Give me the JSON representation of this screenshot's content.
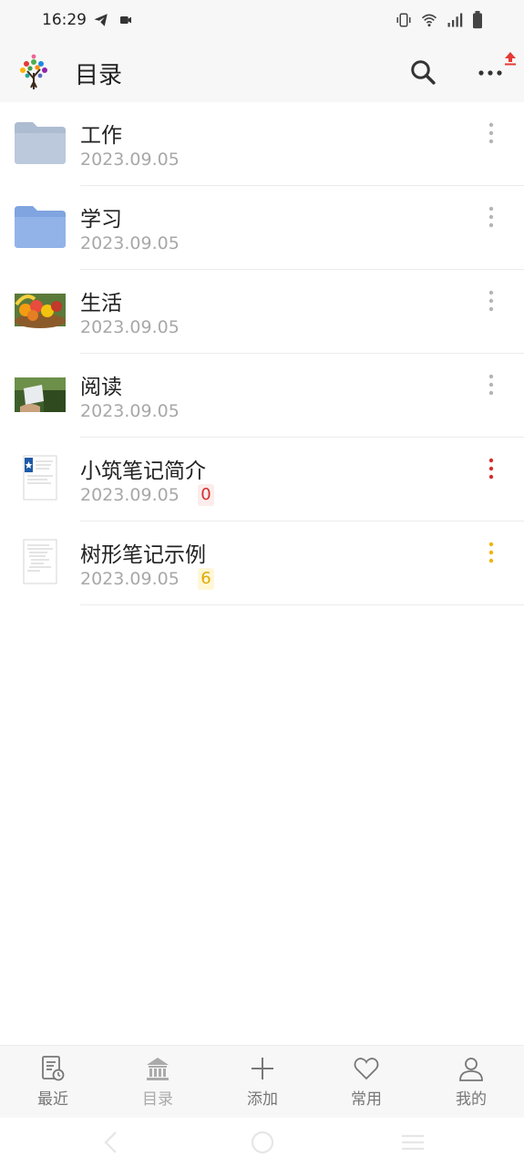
{
  "status_bar": {
    "time": "16:29",
    "left_icons": [
      "telegram-icon",
      "video-icon"
    ],
    "right_icons": [
      "vibrate-icon",
      "wifi-icon",
      "signal-icon",
      "battery-icon"
    ]
  },
  "header": {
    "title": "目录",
    "logo_icon": "tree-logo-icon",
    "search_icon": "search-icon",
    "more_icon": "more-dots-icon",
    "upload_badge_color": "#e53935"
  },
  "items": [
    {
      "name": "工作",
      "date": "2023.09.05",
      "thumb": "folder-gray",
      "count": null,
      "count_color": null,
      "menu_color": "#b5b5b5"
    },
    {
      "name": "学习",
      "date": "2023.09.05",
      "thumb": "folder-blue",
      "count": null,
      "count_color": null,
      "menu_color": "#b5b5b5"
    },
    {
      "name": "生活",
      "date": "2023.09.05",
      "thumb": "fruit-basket-image",
      "count": null,
      "count_color": null,
      "menu_color": "#b5b5b5"
    },
    {
      "name": "阅读",
      "date": "2023.09.05",
      "thumb": "reading-image",
      "count": null,
      "count_color": null,
      "menu_color": "#b5b5b5"
    },
    {
      "name": "小筑笔记简介",
      "date": "2023.09.05",
      "thumb": "doc-bookmark",
      "count": "0",
      "count_color": "#d32f2f",
      "count_bg": "#fdecec",
      "menu_color": "#d32f2f"
    },
    {
      "name": "树形笔记示例",
      "date": "2023.09.05",
      "thumb": "doc-plain",
      "count": "6",
      "count_color": "#e0a800",
      "count_bg": "#fff7d6",
      "menu_color": "#f0b400"
    }
  ],
  "tabbar": {
    "tabs": [
      {
        "label": "最近",
        "icon": "recent-doc-icon",
        "active": false
      },
      {
        "label": "目录",
        "icon": "bank-icon",
        "active": true
      },
      {
        "label": "添加",
        "icon": "plus-icon",
        "active": false
      },
      {
        "label": "常用",
        "icon": "heart-icon",
        "active": false
      },
      {
        "label": "我的",
        "icon": "person-icon",
        "active": false
      }
    ]
  },
  "navigation": [
    "back-icon",
    "home-icon",
    "menu-icon"
  ]
}
